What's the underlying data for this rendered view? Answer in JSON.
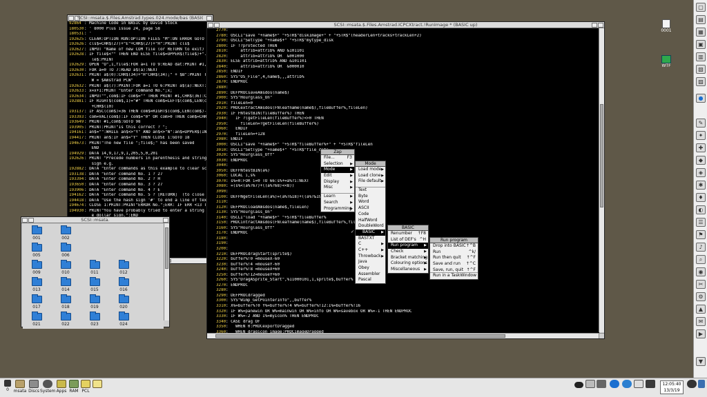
{
  "left_window": {
    "title": "SCSI::msata.$.Files.Amstrad.types.024.mode/bas (BASIC up)",
    "lines": [
      {
        "n": "92864",
        "t": ": Machine Code in BASIC by David Stock"
      },
      {
        "n": "180530",
        "t": ": ' 8000 Plus issue 24, page 58"
      },
      {
        "n": "180531",
        "t": ": '"
      },
      {
        "n": "192625",
        "t": ": CLEAR:OPTION RUN:OPTION FILES \"M\":ON ERROR GOTO 28"
      },
      {
        "n": "192626",
        "t": ": cls$=CHR$(27)+\"E\"+CHR$(27)+\"H\":PRINT cls$"
      },
      {
        "n": "192627",
        "t": ": INPUT \"Name of new COM file (or RETURN to exit) proc"
      },
      {
        "n": "192628",
        "t": ": IF file$<\"\" THEN END ELSE file$=UPPER$(file$)+\".COM"
      },
      {
        "n": "",
        "t": "   le$:PRINT"
      },
      {
        "n": "192629",
        "t": ": OPEN \"O\",1,file$:FOR a=1 TO 9:READ dat:PRINT #1,CHR"
      },
      {
        "n": "192630",
        "t": ": FOR a=0 TO 7:READ a$(a):NEXT"
      },
      {
        "n": "192631",
        "t": ": PRINT a$(0):CHR$(34)+\"H\"CHR$(34);\" + $B\":PRINT TAB("
      },
      {
        "n": "",
        "t": "   W = $Amstrad PCW\""
      },
      {
        "n": "192632",
        "t": ": PRINT a$(7):PRINT:FOR a=1 TO 6:PRINT a$(a):NEXT:PRI"
      },
      {
        "n": "192633",
        "t": ": x=x+1:PRINT \"Enter command No.\";x;"
      },
      {
        "n": "192634",
        "t": ": INPUT\"\",com$:IF com$=\"\" THEN PRINT #1,CHR$(36):CLO"
      },
      {
        "n": "192881",
        "t": ": IF RIGHT$(com$,1)=\"#\" THEN com$=LEFT$(com$,LEN(com"
      },
      {
        "n": "",
        "t": "   +CHR$(10)"
      },
      {
        "n": "193137",
        "t": ": IF ASC(com$)=36 THEN com$=RIGHT$(com$,LEN(com$)-1)"
      },
      {
        "n": "193393",
        "t": ": com=VAL(com$):IF com$=\"0\" OR com>0 THEN com$=CHR$("
      },
      {
        "n": "193649",
        "t": ": PRINT #1,com$:GOTO 98"
      },
      {
        "n": "193905",
        "t": ": PRINT:PRINT\"Is this correct ? \";"
      },
      {
        "n": "194161",
        "t": ": an$=\"\":WHILE an$<>\"Y\" AND an$<>\"N\":an$=UPPER$(INKE"
      },
      {
        "n": "194417",
        "t": ": PRINT an$:IF an$=\"Y\" THEN CLOSE 1:GOTO 18"
      },
      {
        "n": "194673",
        "t": ": PRINT\"The new file \";file$;\" has been saved"
      },
      {
        "n": "",
        "t": "   END"
      },
      {
        "n": "194929",
        "t": ": DATA 14,9,17,9,1,205,5,0,201"
      },
      {
        "n": "192626",
        "t": ": PRINT \"Precede numbers in parenthesis and strings w"
      },
      {
        "n": "",
        "t": "   sign e.g."
      },
      {
        "n": "192882",
        "t": ": DATA \"Enter commands as this example to clear scre"
      },
      {
        "n": "193138",
        "t": ": DATA \"Enter command No. 1 ? 27"
      },
      {
        "n": "193394",
        "t": ": DATA \"Enter command No. 2 ? H"
      },
      {
        "n": "193650",
        "t": ": DATA \"Enter command No. 3 ? 27"
      },
      {
        "n": "193906",
        "t": ": DATA \"Enter command No. 4 ? E"
      },
      {
        "n": "194162",
        "t": ": DATA \"Enter command No. 5 ? [RETURN]  (to close"
      },
      {
        "n": "194418",
        "t": ": DATA \"Use the hash sign '#' to end a line of text"
      },
      {
        "n": "194674",
        "t": ": CLOSE 1:PRINT:PRINT\"ERROR No.\";ERR: IF ERR <13 T"
      },
      {
        "n": "194930",
        "t": ": PRINT\"You have probably tried to enter a string w"
      },
      {
        "n": "",
        "t": "   e dollar sign.\":END"
      }
    ]
  },
  "filer_window": {
    "title": "SCSI::msata.",
    "items": [
      "001",
      "002",
      "005",
      "006",
      "009",
      "010",
      "011",
      "012",
      "013",
      "014",
      "015",
      "016",
      "017",
      "018",
      "019",
      "020",
      "021",
      "022",
      "023",
      "024"
    ]
  },
  "main_window": {
    "title": "SCSI::msata.$.Files.Amstrad.ICPCXtract.!RunImage * (BASIC up)",
    "lines": [
      {
        "n": "2770",
        "t": ":"
      },
      {
        "n": "2780",
        "t": ": OSCLI\"save \"+name$+\" \"+STR$\"diskImage+\" + \"+STR$\"(headerLen+tracks+trackLen+2)"
      },
      {
        "n": "2790",
        "t": ": OSCLI\"SetType \"+name$+\" \"+STR$\"mytype_disk"
      },
      {
        "n": "2800",
        "t": ": IF !?protected THEN"
      },
      {
        "n": "2810",
        "t": ":     attrib=attrib% AND &101101"
      },
      {
        "n": "2820",
        "t": ":     attrib=attrib% OR  &001000"
      },
      {
        "n": "2830",
        "t": ": ELSE attrib=attrib% AND &101101"
      },
      {
        "n": "2840",
        "t": ":     attrib=attrib% OR  &000010"
      },
      {
        "n": "2850",
        "t": ": ENDIF"
      },
      {
        "n": "2860",
        "t": ": SYS\"OS_File\",4,name$,,,attrib%"
      },
      {
        "n": "2870",
        "t": ": ENDPROC"
      },
      {
        "n": "2880",
        "t": ":"
      },
      {
        "n": "2890",
        "t": ": DEFPROCsaveAmsdos(name$)"
      },
      {
        "n": "2900",
        "t": ": SYS\"Hourglass_On\""
      },
      {
        "n": "2910",
        "t": ": fileLen=0"
      },
      {
        "n": "2920",
        "t": ": PROCextractAmsdos(FNleafname(name$),fileBuffer%,fileLen)"
      },
      {
        "n": "2930",
        "t": ": IF FNtestBIN(fileBuffer%) THEN"
      },
      {
        "n": "2940",
        "t": ":   IF ?(getFileLen(fileBuffer%)<>0 THEN"
      },
      {
        "n": "2950",
        "t": ":     fileLen=?getFileLen(fileBuffer%)"
      },
      {
        "n": "2960",
        "t": ":   ENDIF"
      },
      {
        "n": "2970",
        "t": ":   fileLen=+128"
      },
      {
        "n": "2980",
        "t": ": ENDIF"
      },
      {
        "n": "3000",
        "t": ": OSCLI\"save \"+name$+\" \"+STR$\"fileBuffer%+\" + \"+STR$\"fileLen"
      },
      {
        "n": "3010",
        "t": ": OSCLI\"SetType \"+name$+\" \"+STR$\"file_data"
      },
      {
        "n": "3020",
        "t": ": SYS\"Hourglass_Off\""
      },
      {
        "n": "3030",
        "t": ": ENDPROC"
      },
      {
        "n": "3040",
        "t": ":"
      },
      {
        "n": "3050",
        "t": ": DEFFNtestBIN(a%)"
      },
      {
        "n": "3060",
        "t": ": LOCAL i,s%"
      },
      {
        "n": "3070",
        "t": ": s%=0:FOR i=0 TO 66:s%+=a%?i:NEXT"
      },
      {
        "n": "3080",
        "t": ": =(s%<(a%?67)+((a%?68)<<8))"
      },
      {
        "n": "3090",
        "t": ":"
      },
      {
        "n": "3100",
        "t": ": DEFFNgetFileLen(a%)=(a%?&18)+((a%?&19)<<8)"
      },
      {
        "n": "3110",
        "t": ":"
      },
      {
        "n": "3120",
        "t": ": DEFPROCloadAmsdos(name$,fileLen)"
      },
      {
        "n": "3130",
        "t": ": SYS\"Hourglass_On\""
      },
      {
        "n": "3140",
        "t": ": OSCLI\"load \"+name$+\" \"+STR$\"fileBuffer%"
      },
      {
        "n": "3150",
        "t": ": PROCintractAmsdos(FNleafname(name$),fileBuffer%,fileLen)"
      },
      {
        "n": "3160",
        "t": ": SYS\"Hourglass_Off\""
      },
      {
        "n": "3170",
        "t": ": ENDPROC"
      },
      {
        "n": "3180",
        "t": ":"
      },
      {
        "n": "3190",
        "t": ":"
      },
      {
        "n": "3200",
        "t": ":"
      },
      {
        "n": "3210",
        "t": ": DEFPROCdragStart(sprite$)"
      },
      {
        "n": "3220",
        "t": ": buffer%!0 =mouseX-60"
      },
      {
        "n": "3230",
        "t": ": buffer%!4 =mouseY-60"
      },
      {
        "n": "3240",
        "t": ": buffer%!8 =mouseX+60"
      },
      {
        "n": "3250",
        "t": ": buffer%!12=mouseY+60"
      },
      {
        "n": "3260",
        "t": ": SYS\"DragASprite_Start\",%11000101,1,sprite$,buffer%"
      },
      {
        "n": "3270",
        "t": ": ENDPROC"
      },
      {
        "n": "3280",
        "t": ":"
      },
      {
        "n": "3290",
        "t": ": DEFPROCdragged"
      },
      {
        "n": "3300",
        "t": ": SYS\"Wimp_GetPointerInfo\",,buffer%"
      },
      {
        "n": "3310",
        "t": ": X%=buffer%!0 Y%=buffer%!4 W%=buffer%!12:I%=buffer%!16"
      },
      {
        "n": "3320",
        "t": ": IF W%=panewin OR W%=mainwin OR W%=info OR W%=savebox OR W%=-1 THEN ENDPROC"
      },
      {
        "n": "3330",
        "t": ": IF W%=-2 AND I%=myIcon% THEN ENDPROC"
      },
      {
        "n": "3340",
        "t": ": CASE drag OF"
      },
      {
        "n": "3350",
        "t": ":   WHEN 0:PROCexportDragged"
      },
      {
        "n": "3360",
        "t": ":   WHEN dragicon_image:PROCimageDragged"
      },
      {
        "n": "3370",
        "t": ":   WHEN dragicon_amsdosfiles:PROCamsdosDragged"
      },
      {
        "n": "3380",
        "t": ": ENDCASE"
      }
    ]
  },
  "menus": {
    "zap": {
      "title": "Zap",
      "items": [
        {
          "label": "File...",
          "shortcut": "F3"
        },
        {
          "label": "Selection",
          "shortcut": ""
        },
        {
          "label": "Mode",
          "shortcut": ""
        },
        {
          "label": "Edit",
          "shortcut": ""
        },
        {
          "label": "Display",
          "shortcut": ""
        },
        {
          "label": "Misc",
          "shortcut": ""
        },
        {
          "label": "",
          "shortcut": ""
        },
        {
          "label": "Learn",
          "shortcut": ""
        },
        {
          "label": "Search",
          "shortcut": ""
        },
        {
          "label": "Programming",
          "shortcut": ""
        }
      ]
    },
    "mode": {
      "title": "Mode",
      "items": [
        "Load mode",
        "Load clone",
        "File default",
        "",
        "Text",
        "Byte",
        "Word",
        "ASCII",
        "Code",
        "HalfWord",
        "DoubleWord",
        "BASIC",
        "BASTXT",
        "C",
        "C++",
        "Throwback",
        "Java",
        "Obey",
        "Assembler",
        "Pascal"
      ]
    },
    "basic": {
      "title": "BASIC",
      "items": [
        {
          "label": "Renumber",
          "shortcut": "↑F8"
        },
        {
          "label": "List of DEF's",
          "shortcut": "^H"
        },
        {
          "label": "Run program",
          "shortcut": ""
        },
        {
          "label": "Check",
          "shortcut": ""
        },
        {
          "label": "Bracket matching",
          "shortcut": ""
        },
        {
          "label": "Colouring options",
          "shortcut": ""
        },
        {
          "label": "Miscellaneous",
          "shortcut": ""
        }
      ]
    },
    "run": {
      "title": "Run program",
      "items": [
        {
          "label": "Drop into BASIC",
          "shortcut": "↑^B"
        },
        {
          "label": "Run",
          "shortcut": "^k/"
        },
        {
          "label": "Run then quit",
          "shortcut": "↑^F"
        },
        {
          "label": "Save and run",
          "shortcut": "↑^C"
        },
        {
          "label": "Save, run, quit",
          "shortcut": "↑^F"
        },
        {
          "label": "Run in a TaskWindow",
          "shortcut": ""
        }
      ]
    }
  },
  "desktop": {
    "icon_0001": "0001",
    "icon_wtf": "WTF"
  },
  "iconbar": {
    "items": [
      {
        "label": "0",
        "icon": "floppy-icon"
      },
      {
        "label": "msata",
        "icon": "hard-disc-icon"
      },
      {
        "label": "Discs",
        "icon": "discs-icon"
      },
      {
        "label": "System",
        "icon": "system-icon"
      },
      {
        "label": "Apps",
        "icon": "apps-icon"
      },
      {
        "label": "RAM",
        "icon": "ram-disc-icon"
      },
      {
        "label": "PCL",
        "icon": "pcl-icon"
      }
    ],
    "clock_time": "12:05:40",
    "clock_date": "13/3/19"
  }
}
